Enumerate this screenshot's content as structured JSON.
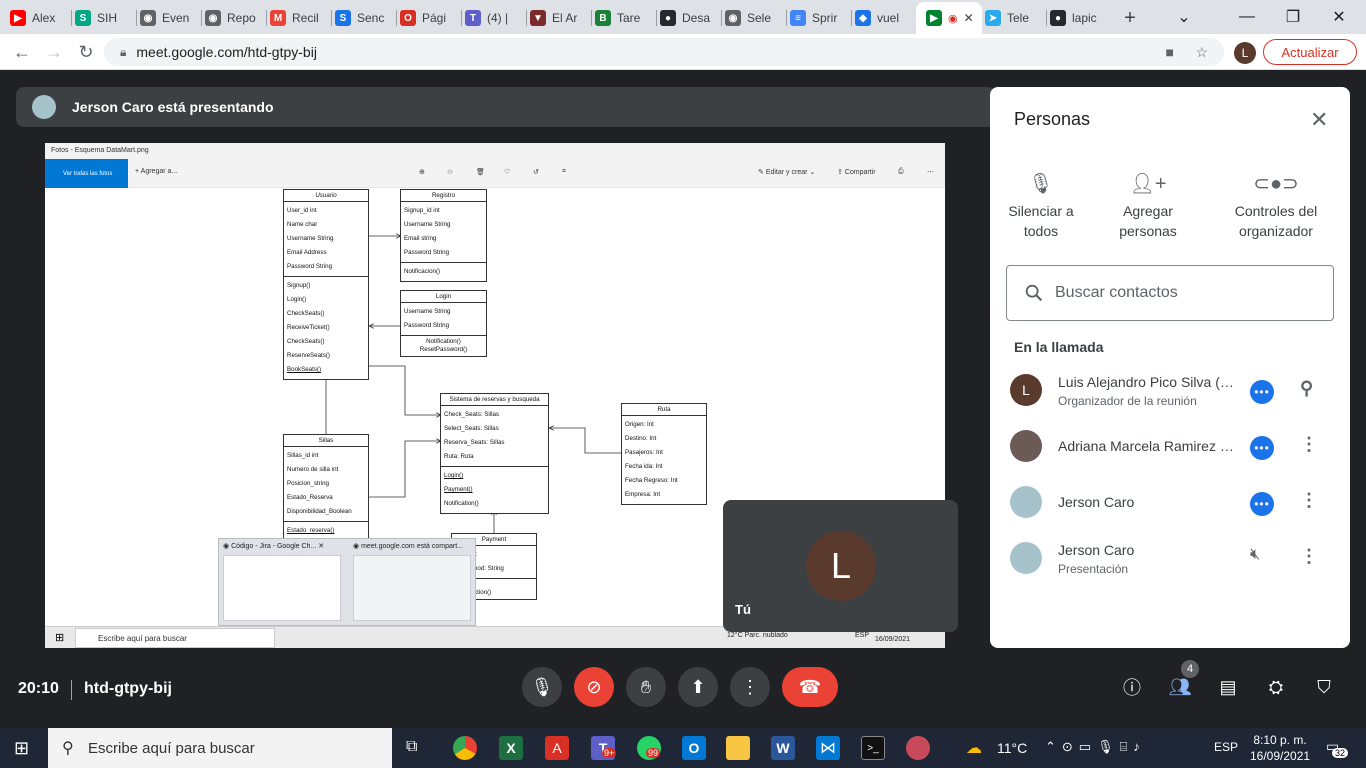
{
  "browser": {
    "tabs": [
      {
        "label": "Alex",
        "color": "#ff0000",
        "glyph": "▶"
      },
      {
        "label": "SIH",
        "color": "#00a884",
        "glyph": "S"
      },
      {
        "label": "Even",
        "color": "#5f6368",
        "glyph": "◉"
      },
      {
        "label": "Repo",
        "color": "#5f6368",
        "glyph": "◉"
      },
      {
        "label": "Recil",
        "color": "#ea4335",
        "glyph": "M"
      },
      {
        "label": "Senc",
        "color": "#1a73e8",
        "glyph": "S"
      },
      {
        "label": "Pági",
        "color": "#d93025",
        "glyph": "O"
      },
      {
        "label": "(4) |",
        "color": "#5b5fc7",
        "glyph": "T"
      },
      {
        "label": "El Ar",
        "color": "#7a2b2b",
        "glyph": "▼"
      },
      {
        "label": "Tare",
        "color": "#188038",
        "glyph": "B"
      },
      {
        "label": "Desa",
        "color": "#24292e",
        "glyph": "●"
      },
      {
        "label": "Sele",
        "color": "#5f6368",
        "glyph": "◉"
      },
      {
        "label": "Sprir",
        "color": "#4285f4",
        "glyph": "≡"
      },
      {
        "label": "vuel",
        "color": "#1a73e8",
        "glyph": "◆"
      },
      {
        "label": "",
        "color": "#00832d",
        "glyph": "▶"
      },
      {
        "label": "Tele",
        "color": "#2aabee",
        "glyph": "➤"
      },
      {
        "label": "lapic",
        "color": "#24292e",
        "glyph": "●"
      }
    ],
    "new_tab": "+",
    "url": "meet.google.com/htd-gtpy-bij",
    "profile_initial": "L",
    "update_label": "Actualizar"
  },
  "meet": {
    "presenting_text": "Jerson Caro está presentando",
    "clock": "20:10",
    "meeting_code": "htd-gtpy-bij",
    "participant_count": "4",
    "self_label": "Tú",
    "self_initial": "L"
  },
  "shared_screen": {
    "window_title": "Fotos - Esquema DataMart.png",
    "view_all": "Ver todas las fotos",
    "add_to": "Agregar a...",
    "edit_create": "Editar y crear",
    "share": "Compartir",
    "uml": {
      "usuario": {
        "title": "Usuario",
        "attrs": [
          "User_id int",
          "Name char",
          "Username String",
          "Email Address",
          "Password String"
        ],
        "methods": [
          "Signup()",
          "Login()",
          "CheckSeats()",
          "ReceiveTicket()",
          "CheckSeats()",
          "ReserveSeats()",
          "BookSeats()"
        ]
      },
      "registro": {
        "title": "Registro",
        "attrs": [
          "Signup_id int",
          "Username String",
          "Email string",
          "Password String"
        ],
        "methods": [
          "Notificacion()"
        ]
      },
      "login": {
        "title": "Login",
        "attrs": [
          "Username String",
          "Password String"
        ],
        "methods": [
          "Notification()",
          "ResetPassword()"
        ]
      },
      "sistema": {
        "title": "Sistema de reservas y busqueda",
        "attrs": [
          "Check_Seats: Sillas",
          "Select_Seats: Sillas",
          "Reserva_Seats: Sillas",
          "Ruta: Ruta"
        ],
        "methods": [
          "Login()",
          "Payment()",
          "Notification()"
        ]
      },
      "ruta": {
        "title": "Ruta",
        "attrs": [
          "Origen: Int",
          "Destino: Int",
          "Pasajeros: Int",
          "Fecha ida: Int",
          "Fecha Regreso: Int",
          "Empresa: Int"
        ]
      },
      "sillas": {
        "title": "Sillas",
        "attrs": [
          "Sillas_id int",
          "Numero de silla int",
          "Posicion_string",
          "Estado_Reserva",
          "Disponibilidad_Boolean"
        ],
        "methods": [
          "Estado_reserva()"
        ]
      },
      "payment": {
        "title": "Payment",
        "attrs": [
          "nt_id int",
          "entMethod: String"
        ],
        "methods": [
          "Credit()",
          "Transaction()"
        ]
      }
    },
    "thumb1": "Código - Jira - Google Ch...",
    "thumb2": "meet.google.com está compart...",
    "taskbar_search": "Escribe aquí para buscar",
    "weather": "12°C  Parc. nublado",
    "lang": "ESP",
    "date": "16/09/2021"
  },
  "people_panel": {
    "title": "Personas",
    "actions": [
      {
        "line1": "Silenciar a",
        "line2": "todos"
      },
      {
        "line1": "Agregar",
        "line2": "personas"
      },
      {
        "line1": "Controles del",
        "line2": "organizador"
      }
    ],
    "search_placeholder": "Buscar contactos",
    "section": "En la llamada",
    "participants": [
      {
        "name": "Luis Alejandro Pico Silva (Tú)",
        "subtitle": "Organizador de la reunión",
        "avatar_color": "#5b3a2e",
        "initial": "L"
      },
      {
        "name": "Adriana Marcela Ramirez Si...",
        "subtitle": "",
        "avatar_color": "#6b5a55",
        "initial": ""
      },
      {
        "name": "Jerson Caro",
        "subtitle": "",
        "avatar_color": "#a6c3cc",
        "initial": ""
      },
      {
        "name": "Jerson Caro",
        "subtitle": "Presentación",
        "avatar_color": "#a6c3cc",
        "initial": ""
      }
    ]
  },
  "windows": {
    "search": "Escribe aquí para buscar",
    "temperature": "11°C",
    "lang": "ESP",
    "time": "8:10 p. m.",
    "date": "16/09/2021",
    "notifications": "32",
    "whatsapp_badge": "99",
    "teams_badge": "9+"
  }
}
